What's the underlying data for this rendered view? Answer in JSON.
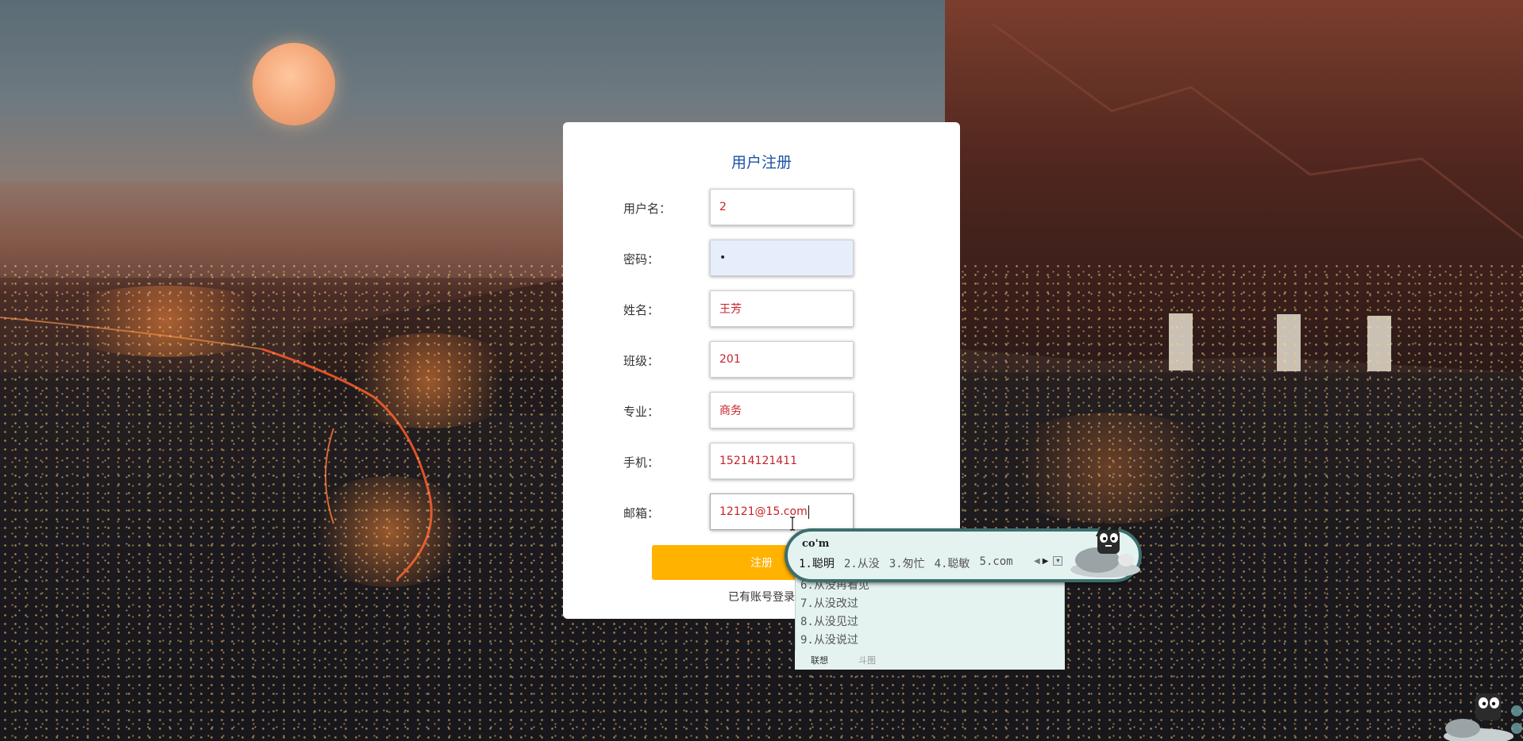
{
  "form": {
    "title": "用户注册",
    "fields": [
      {
        "label": "用户名：",
        "value": "2"
      },
      {
        "label": "密码：",
        "value": "•"
      },
      {
        "label": "姓名：",
        "value": "王芳"
      },
      {
        "label": "班级：",
        "value": "201"
      },
      {
        "label": "专业：",
        "value": "商务"
      },
      {
        "label": "手机：",
        "value": "15214121411"
      },
      {
        "label": "邮箱：",
        "value": "12121@15.com"
      }
    ],
    "submit_label": "注册",
    "login_link": "已有账号登录"
  },
  "ime": {
    "composition": "co'm",
    "row1": [
      "1.聪明",
      "2.从没",
      "3.匆忙",
      "4.聪敏",
      "5.com"
    ],
    "list": [
      "6.从没再看见",
      "7.从没改过",
      "8.从没见过",
      "9.从没说过"
    ],
    "footer": [
      "联想",
      "斗图"
    ]
  },
  "colors": {
    "title": "#1f52a6",
    "input_text": "#c8202a",
    "button": "#ffb200",
    "ime_bg": "#e4f3f0",
    "ime_border": "#3d6e6d"
  },
  "icons": [
    "ime-mascot-icon",
    "ime-prev-arrow-icon",
    "ime-next-arrow-icon",
    "ime-menu-icon",
    "ibeam-cursor-icon"
  ]
}
